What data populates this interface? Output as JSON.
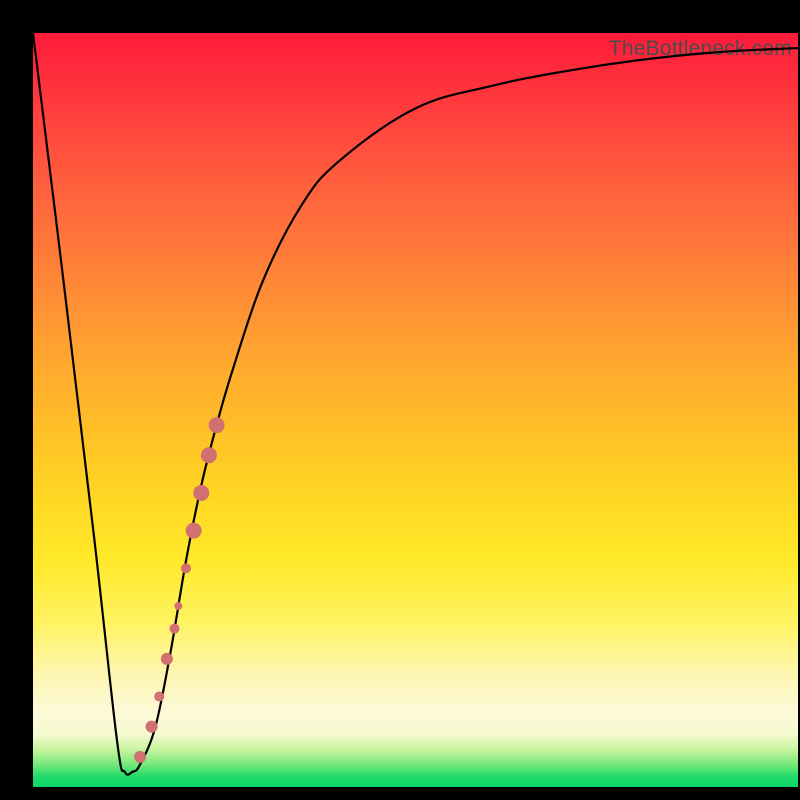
{
  "watermark": "TheBottleneck.com",
  "chart_data": {
    "type": "line",
    "title": "",
    "xlabel": "",
    "ylabel": "",
    "xlim": [
      0,
      100
    ],
    "ylim": [
      0,
      100
    ],
    "curve": {
      "name": "bottleneck-curve",
      "x": [
        0,
        4,
        8,
        11,
        12,
        13,
        14,
        16,
        18,
        20,
        22,
        24,
        26,
        30,
        35,
        40,
        50,
        60,
        70,
        80,
        90,
        100
      ],
      "y": [
        100,
        67,
        33,
        6,
        2,
        2,
        3,
        8,
        18,
        30,
        40,
        48,
        55,
        67,
        77,
        83,
        90,
        93,
        95,
        96.5,
        97.5,
        98
      ]
    },
    "highlight_points": {
      "name": "highlight-dots",
      "color": "#d07070",
      "points": [
        {
          "x": 14.0,
          "y": 4,
          "r": 6
        },
        {
          "x": 15.5,
          "y": 8,
          "r": 6
        },
        {
          "x": 16.5,
          "y": 12,
          "r": 5
        },
        {
          "x": 17.5,
          "y": 17,
          "r": 6
        },
        {
          "x": 18.5,
          "y": 21,
          "r": 5
        },
        {
          "x": 19.0,
          "y": 24,
          "r": 4
        },
        {
          "x": 20.0,
          "y": 29,
          "r": 5
        },
        {
          "x": 21.0,
          "y": 34,
          "r": 8
        },
        {
          "x": 22.0,
          "y": 39,
          "r": 8
        },
        {
          "x": 23.0,
          "y": 44,
          "r": 8
        },
        {
          "x": 24.0,
          "y": 48,
          "r": 8
        }
      ]
    },
    "gradient_stops": [
      {
        "pos": 0,
        "color": "#ff1a3a"
      },
      {
        "pos": 50,
        "color": "#ffc327"
      },
      {
        "pos": 90,
        "color": "#fdf9d8"
      },
      {
        "pos": 100,
        "color": "#0bd468"
      }
    ]
  }
}
